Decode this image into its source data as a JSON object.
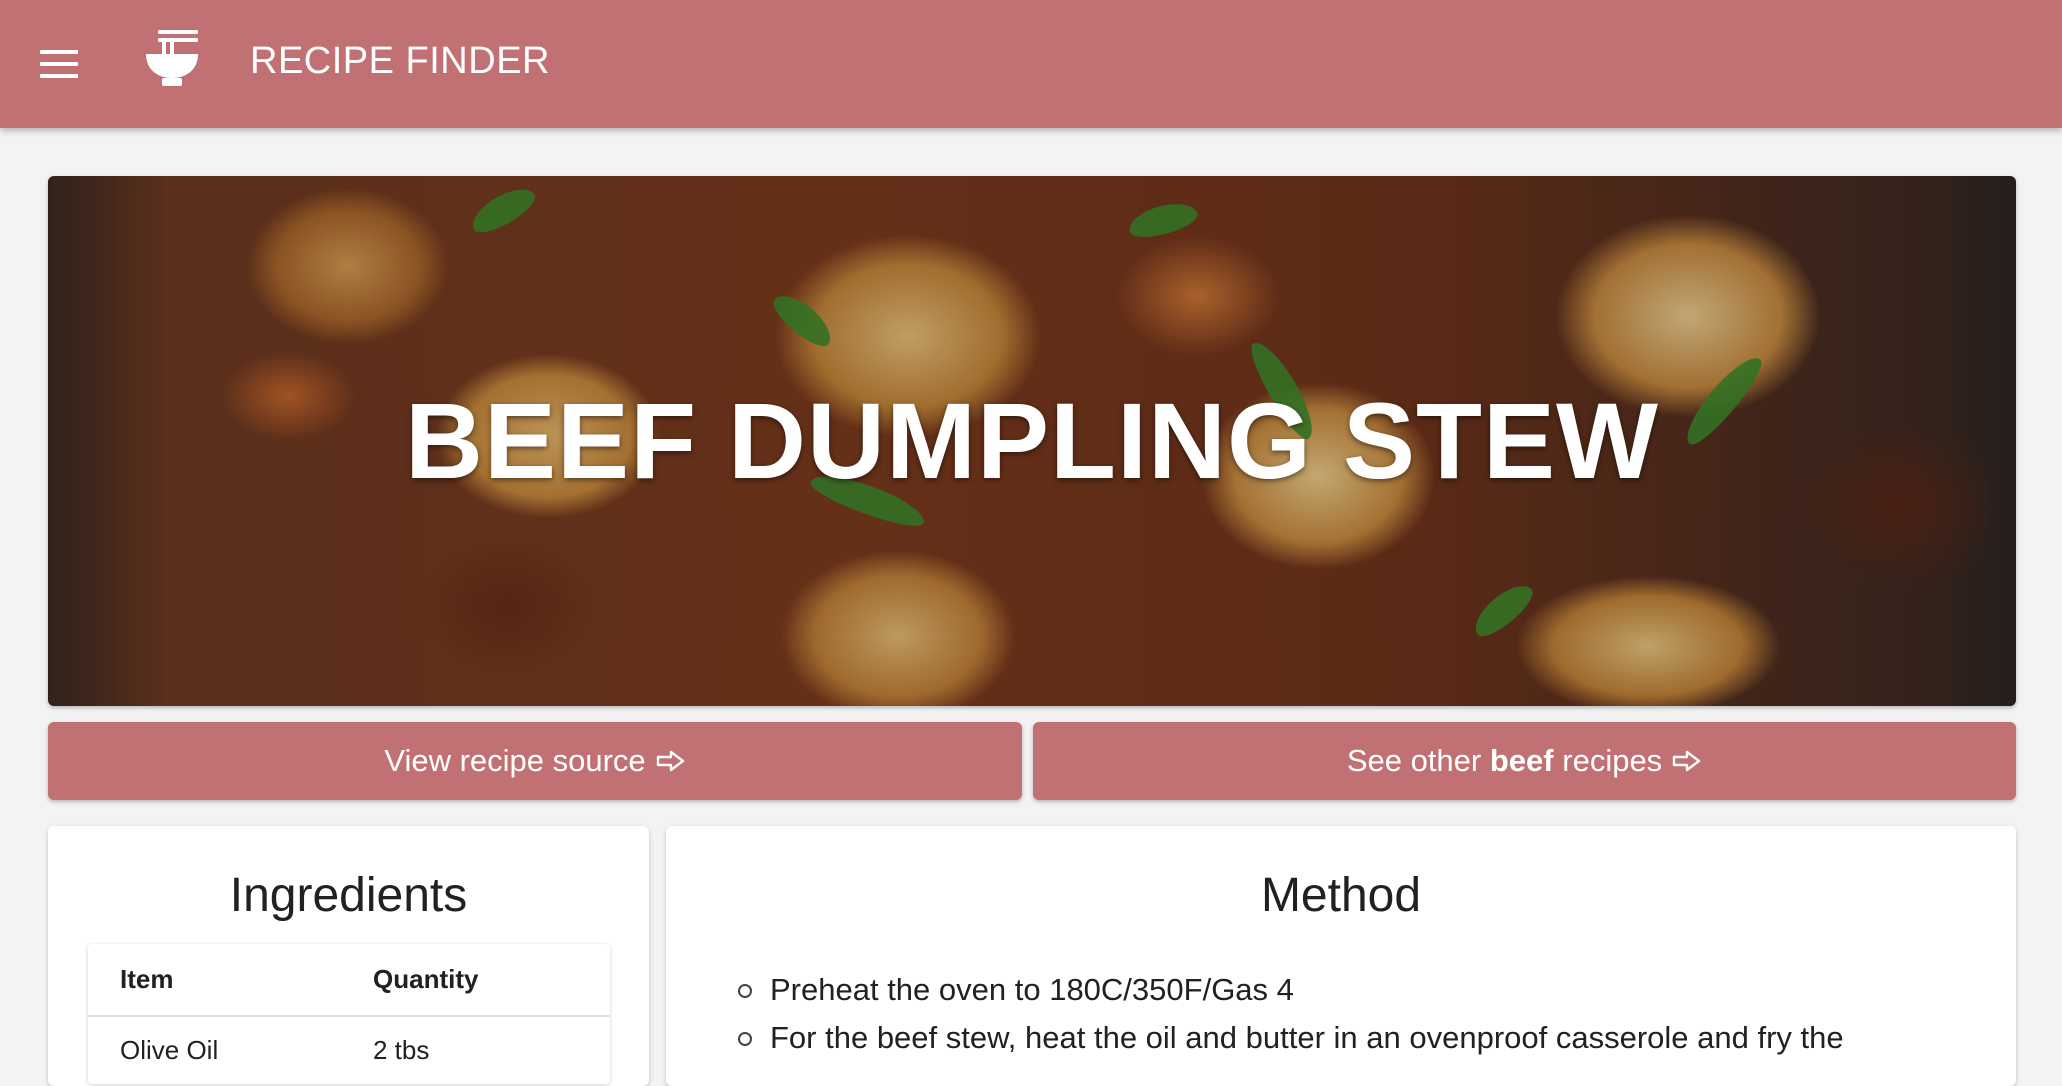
{
  "appbar": {
    "title": "RECIPE FINDER",
    "menu_icon": "hamburger-menu-icon",
    "logo_icon": "noodle-bowl-icon",
    "color": "#c17173"
  },
  "hero": {
    "title": "BEEF DUMPLING STEW"
  },
  "actions": {
    "source_label": "View recipe source",
    "other_prefix": "See other",
    "other_category": "beef",
    "other_suffix": "recipes",
    "arrow_icon": "arrow-right-outline-icon"
  },
  "ingredients": {
    "heading": "Ingredients",
    "columns": [
      "Item",
      "Quantity"
    ],
    "rows": [
      {
        "item": "Olive Oil",
        "quantity": "2 tbs"
      }
    ]
  },
  "method": {
    "heading": "Method",
    "steps": [
      "Preheat the oven to 180C/350F/Gas 4",
      "For the beef stew, heat the oil and butter in an ovenproof casserole and fry the"
    ]
  }
}
